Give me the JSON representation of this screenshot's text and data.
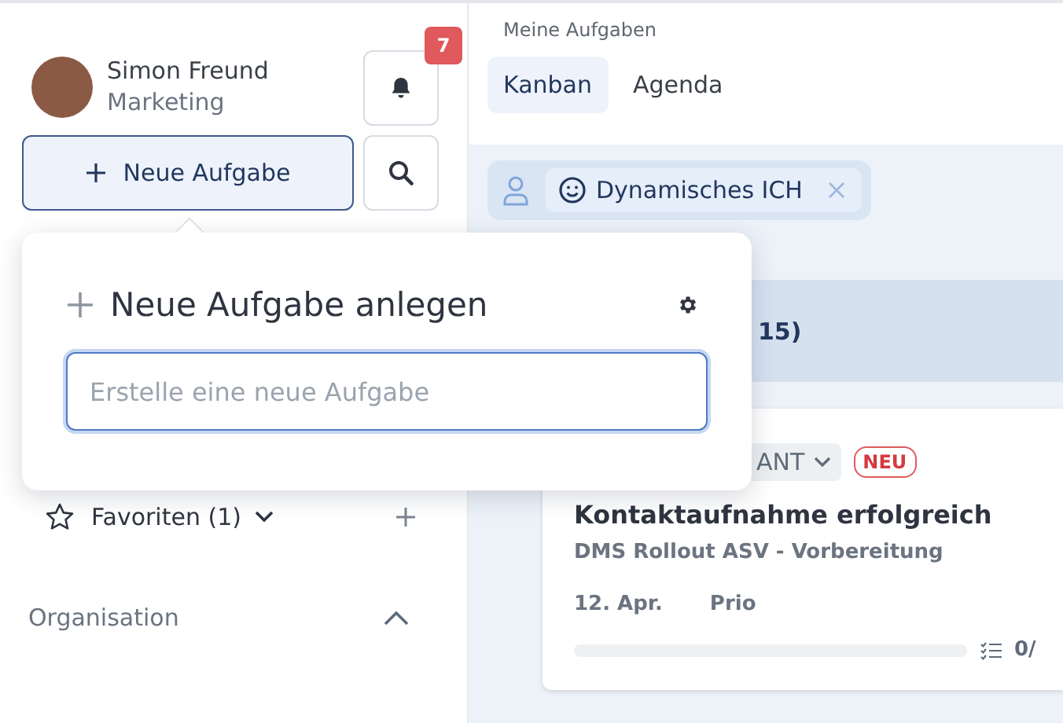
{
  "user": {
    "name": "Simon Freund",
    "department": "Marketing"
  },
  "notifications": {
    "count": "7"
  },
  "new_task_button": {
    "label": "Neue Aufgabe"
  },
  "favorites": {
    "label": "Favoriten (1)",
    "expanded": false
  },
  "sections": [
    {
      "label": "Organisation",
      "expanded": true
    }
  ],
  "page_title": "Meine Aufgaben",
  "tabs": [
    {
      "label": "Kanban",
      "selected": true
    },
    {
      "label": "Agenda",
      "selected": false
    }
  ],
  "filter": {
    "chip": "Dynamisches ICH"
  },
  "column": {
    "count": "15)"
  },
  "card": {
    "tag": "ANT",
    "badge": "NEU",
    "title": "Kontaktaufnahme erfolgreich",
    "project": "DMS Rollout ASV - Vorbereitung",
    "date": "12. Apr.",
    "priority": "Prio",
    "level": 0,
    "checklist": "0/"
  },
  "popup": {
    "title": "Neue Aufgabe anlegen",
    "placeholder": "Erstelle eine neue Aufgabe"
  }
}
